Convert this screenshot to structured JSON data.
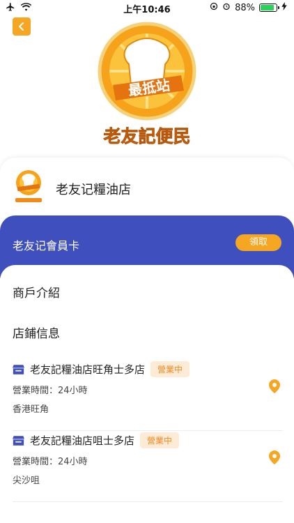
{
  "status_bar": {
    "time": "上午10:46",
    "battery_percent": "88%",
    "battery_level": 0.88
  },
  "brand": {
    "logo_top_text": "最抵站",
    "logo_bottom_text": "老友記便民",
    "accent_color": "#f5a623",
    "band_color": "#3f4fbe"
  },
  "store": {
    "name": "老友记糧油店"
  },
  "membership": {
    "title": "老友记會員卡",
    "claim_label": "領取"
  },
  "sections": {
    "intro": "商戶介紹",
    "store_info": "店鋪信息"
  },
  "branches": [
    {
      "name": "老友記糧油店旺角士多店",
      "status": "營業中",
      "hours": "營業時間：24小時",
      "address": "香港旺角"
    },
    {
      "name": "老友記糧油店咀士多店",
      "status": "營業中",
      "hours": "營業時間：24小時",
      "address": "尖沙咀"
    }
  ]
}
